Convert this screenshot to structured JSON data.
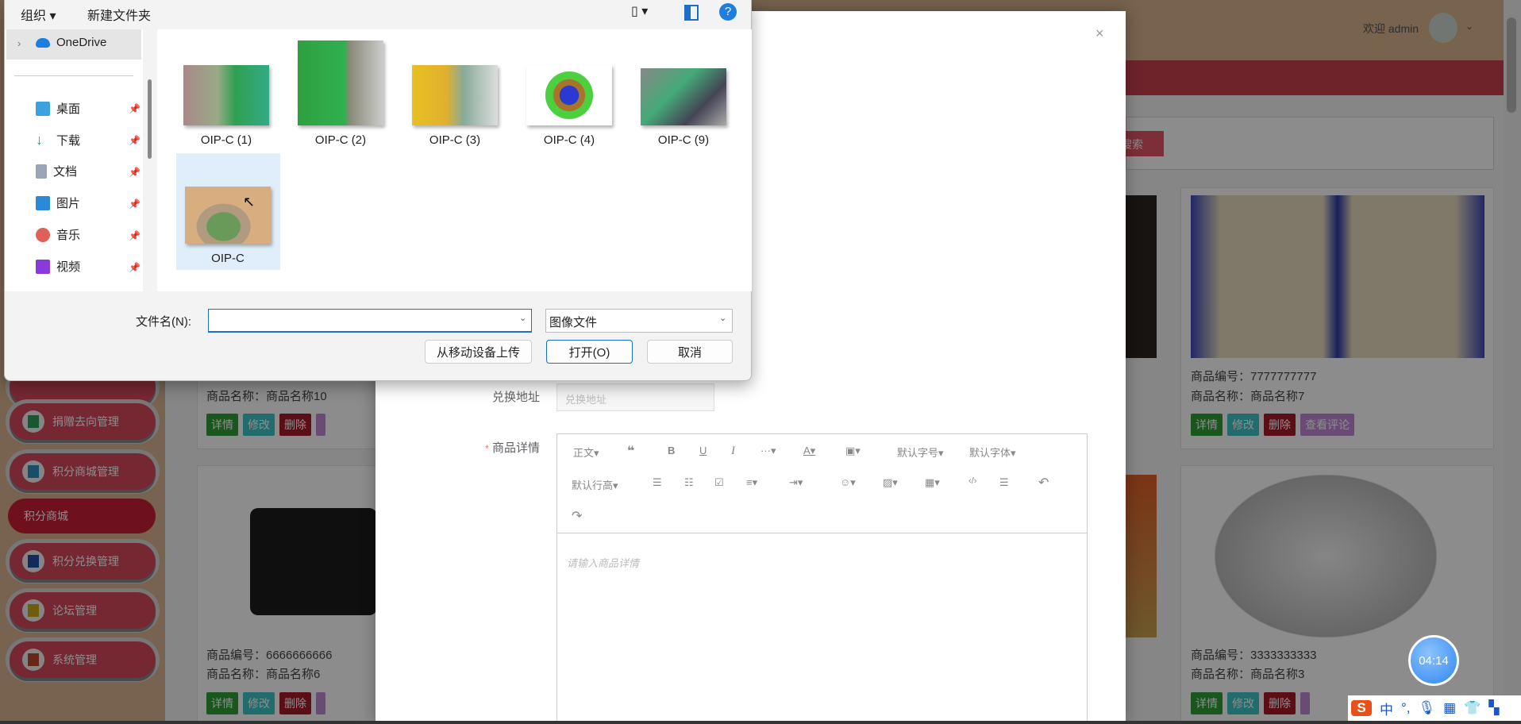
{
  "app": {
    "welcome": "欢迎 admin",
    "search_button": "搜索"
  },
  "sidebar": {
    "items": [
      {
        "label": "捐赠去向管理",
        "color": "#2f9e5a"
      },
      {
        "label": "积分商城管理",
        "color": "#2a8fc0"
      },
      {
        "label": "积分商城",
        "active": true
      },
      {
        "label": "积分兑换管理",
        "color": "#1e4fa8"
      },
      {
        "label": "论坛管理",
        "color": "#c9a915"
      },
      {
        "label": "系统管理",
        "color": "#c04a2a"
      }
    ]
  },
  "products": [
    {
      "name": "商品名称：商品名称10"
    },
    {
      "code": "商品编号：6666666666",
      "name": "商品名称：商品名称6"
    },
    {
      "code": "商品编号：7777777777",
      "name": "商品名称：商品名称7"
    },
    {
      "code": "商品编号：3333333333",
      "name": "商品名称：商品名称3"
    }
  ],
  "card_buttons": {
    "detail": "详情",
    "edit": "修改",
    "delete": "删除",
    "comments": "查看评论"
  },
  "modal": {
    "close": "×",
    "address_label": "兑换地址",
    "address_placeholder": "兑换地址",
    "detail_label": "商品详情",
    "required": "*",
    "editor_placeholder": "请输入商品详情",
    "toolbar": {
      "paragraph": "正文",
      "font_size": "默认字号",
      "font_family": "默认字体",
      "line_height": "默认行高"
    }
  },
  "file_dialog": {
    "organize": "组织",
    "new_folder": "新建文件夹",
    "nav": [
      "OneDrive",
      "桌面",
      "下载",
      "文档",
      "图片",
      "音乐",
      "视频"
    ],
    "files": [
      "OIP-C (1)",
      "OIP-C (2)",
      "OIP-C (3)",
      "OIP-C (4)",
      "OIP-C (9)",
      "OIP-C"
    ],
    "filename_label": "文件名(N):",
    "filename_value": "",
    "filetype": "图像文件",
    "upload_mobile": "从移动设备上传",
    "open": "打开(O)",
    "cancel": "取消"
  },
  "timer": "04:14",
  "ime": {
    "lang": "中",
    "punct": "°,"
  }
}
